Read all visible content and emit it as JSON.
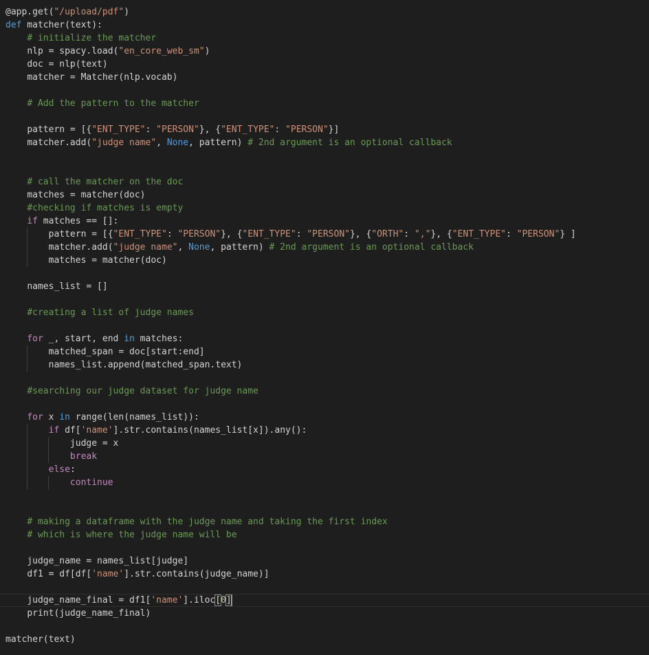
{
  "editor": {
    "theme": {
      "background": "#1e1e1e",
      "plain": "#d4d4d4",
      "keyword": "#569cd6",
      "control": "#c586c0",
      "string": "#ce9178",
      "comment": "#6a9955",
      "number": "#b5cea8"
    },
    "lines": [
      {
        "indent": 0,
        "tokens": [
          [
            "p",
            "@app.get("
          ],
          [
            "s",
            "\"/upload/pdf\""
          ],
          [
            "p",
            ")"
          ]
        ]
      },
      {
        "indent": 0,
        "tokens": [
          [
            "k",
            "def"
          ],
          [
            "p",
            " matcher(text):"
          ]
        ]
      },
      {
        "indent": 1,
        "tokens": [
          [
            "c",
            "# initialize the matcher"
          ]
        ]
      },
      {
        "indent": 1,
        "tokens": [
          [
            "p",
            "nlp = spacy.load("
          ],
          [
            "s",
            "\"en_core_web_sm\""
          ],
          [
            "p",
            ")"
          ]
        ]
      },
      {
        "indent": 1,
        "tokens": [
          [
            "p",
            "doc = nlp(text)"
          ]
        ]
      },
      {
        "indent": 1,
        "tokens": [
          [
            "p",
            "matcher = Matcher(nlp.vocab)"
          ]
        ]
      },
      {
        "indent": 1,
        "tokens": []
      },
      {
        "indent": 1,
        "tokens": [
          [
            "c",
            "# Add the pattern to the matcher"
          ]
        ]
      },
      {
        "indent": 1,
        "tokens": []
      },
      {
        "indent": 1,
        "tokens": [
          [
            "p",
            "pattern = [{"
          ],
          [
            "s",
            "\"ENT_TYPE\""
          ],
          [
            "p",
            ": "
          ],
          [
            "s",
            "\"PERSON\""
          ],
          [
            "p",
            "}, {"
          ],
          [
            "s",
            "\"ENT_TYPE\""
          ],
          [
            "p",
            ": "
          ],
          [
            "s",
            "\"PERSON\""
          ],
          [
            "p",
            "}]"
          ]
        ]
      },
      {
        "indent": 1,
        "tokens": [
          [
            "p",
            "matcher.add("
          ],
          [
            "s",
            "\"judge name\""
          ],
          [
            "p",
            ", "
          ],
          [
            "k",
            "None"
          ],
          [
            "p",
            ", pattern) "
          ],
          [
            "c",
            "# 2nd argument is an optional callback"
          ]
        ]
      },
      {
        "indent": 1,
        "tokens": []
      },
      {
        "indent": 1,
        "tokens": []
      },
      {
        "indent": 1,
        "tokens": [
          [
            "c",
            "# call the matcher on the doc"
          ]
        ]
      },
      {
        "indent": 1,
        "tokens": [
          [
            "p",
            "matches = matcher(doc)"
          ]
        ]
      },
      {
        "indent": 1,
        "tokens": [
          [
            "c",
            "#checking if matches is empty"
          ]
        ]
      },
      {
        "indent": 1,
        "tokens": [
          [
            "x",
            "if"
          ],
          [
            "p",
            " matches == []:"
          ]
        ]
      },
      {
        "indent": 2,
        "tokens": [
          [
            "p",
            "pattern = [{"
          ],
          [
            "s",
            "\"ENT_TYPE\""
          ],
          [
            "p",
            ": "
          ],
          [
            "s",
            "\"PERSON\""
          ],
          [
            "p",
            "}, {"
          ],
          [
            "s",
            "\"ENT_TYPE\""
          ],
          [
            "p",
            ": "
          ],
          [
            "s",
            "\"PERSON\""
          ],
          [
            "p",
            "}, {"
          ],
          [
            "s",
            "\"ORTH\""
          ],
          [
            "p",
            ": "
          ],
          [
            "s",
            "\",\""
          ],
          [
            "p",
            "}, {"
          ],
          [
            "s",
            "\"ENT_TYPE\""
          ],
          [
            "p",
            ": "
          ],
          [
            "s",
            "\"PERSON\""
          ],
          [
            "p",
            "} ]"
          ]
        ]
      },
      {
        "indent": 2,
        "tokens": [
          [
            "p",
            "matcher.add("
          ],
          [
            "s",
            "\"judge name\""
          ],
          [
            "p",
            ", "
          ],
          [
            "k",
            "None"
          ],
          [
            "p",
            ", pattern) "
          ],
          [
            "c",
            "# 2nd argument is an optional callback"
          ]
        ]
      },
      {
        "indent": 2,
        "tokens": [
          [
            "p",
            "matches = matcher(doc)"
          ]
        ]
      },
      {
        "indent": 1,
        "tokens": []
      },
      {
        "indent": 1,
        "tokens": [
          [
            "p",
            "names_list = []"
          ]
        ]
      },
      {
        "indent": 1,
        "tokens": []
      },
      {
        "indent": 1,
        "tokens": [
          [
            "c",
            "#creating a list of judge names"
          ]
        ]
      },
      {
        "indent": 1,
        "tokens": []
      },
      {
        "indent": 1,
        "tokens": [
          [
            "x",
            "for"
          ],
          [
            "p",
            " _, start, end "
          ],
          [
            "k",
            "in"
          ],
          [
            "p",
            " matches:"
          ]
        ]
      },
      {
        "indent": 2,
        "tokens": [
          [
            "p",
            "matched_span = doc[start:end]"
          ]
        ]
      },
      {
        "indent": 2,
        "tokens": [
          [
            "p",
            "names_list.append(matched_span.text)"
          ]
        ]
      },
      {
        "indent": 1,
        "tokens": []
      },
      {
        "indent": 1,
        "tokens": [
          [
            "c",
            "#searching our judge dataset for judge name"
          ]
        ]
      },
      {
        "indent": 1,
        "tokens": []
      },
      {
        "indent": 1,
        "tokens": [
          [
            "x",
            "for"
          ],
          [
            "p",
            " x "
          ],
          [
            "k",
            "in"
          ],
          [
            "p",
            " range(len(names_list)):"
          ]
        ]
      },
      {
        "indent": 2,
        "tokens": [
          [
            "x",
            "if"
          ],
          [
            "p",
            " df["
          ],
          [
            "s",
            "'name'"
          ],
          [
            "p",
            "].str.contains(names_list[x]).any():"
          ]
        ]
      },
      {
        "indent": 3,
        "tokens": [
          [
            "p",
            "judge = x"
          ]
        ]
      },
      {
        "indent": 3,
        "tokens": [
          [
            "x",
            "break"
          ]
        ]
      },
      {
        "indent": 2,
        "tokens": [
          [
            "x",
            "else"
          ],
          [
            "p",
            ":"
          ]
        ]
      },
      {
        "indent": 3,
        "tokens": [
          [
            "x",
            "continue"
          ]
        ]
      },
      {
        "indent": 1,
        "tokens": []
      },
      {
        "indent": 1,
        "tokens": []
      },
      {
        "indent": 1,
        "tokens": [
          [
            "c",
            "# making a dataframe with the judge name and taking the first index"
          ]
        ]
      },
      {
        "indent": 1,
        "tokens": [
          [
            "c",
            "# which is where the judge name will be"
          ]
        ]
      },
      {
        "indent": 1,
        "tokens": []
      },
      {
        "indent": 1,
        "tokens": [
          [
            "p",
            "judge_name = names_list[judge]"
          ]
        ]
      },
      {
        "indent": 1,
        "tokens": [
          [
            "p",
            "df1 = df[df["
          ],
          [
            "s",
            "'name'"
          ],
          [
            "p",
            "].str.contains(judge_name)]"
          ]
        ]
      },
      {
        "indent": 1,
        "tokens": []
      },
      {
        "indent": 1,
        "current": true,
        "tokens": [
          [
            "p",
            "judge_name_final = df1["
          ],
          [
            "s",
            "'name'"
          ],
          [
            "p",
            "].iloc"
          ],
          [
            "b",
            "["
          ],
          [
            "n",
            "0"
          ],
          [
            "b",
            "]"
          ],
          [
            "cur",
            ""
          ]
        ]
      },
      {
        "indent": 1,
        "tokens": [
          [
            "p",
            "print(judge_name_final)"
          ]
        ]
      },
      {
        "indent": 0,
        "tokens": []
      },
      {
        "indent": 0,
        "tokens": [
          [
            "p",
            "matcher(text)"
          ]
        ]
      }
    ]
  }
}
